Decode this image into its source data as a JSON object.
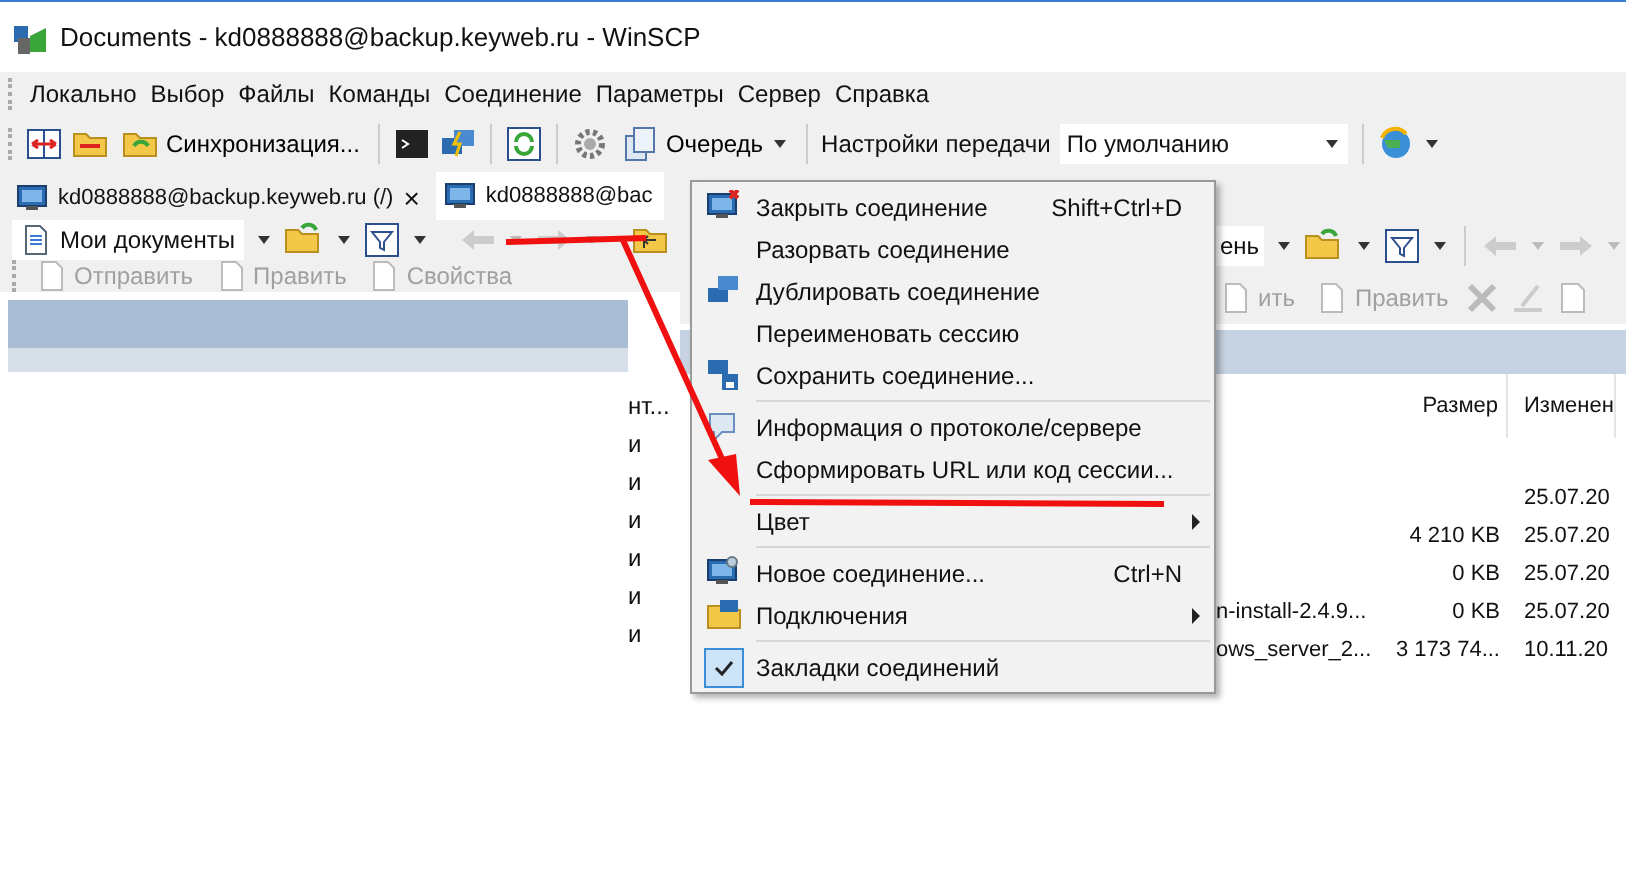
{
  "window": {
    "title": "Documents - kd0888888@backup.keyweb.ru - WinSCP"
  },
  "menu_bar": [
    "Локально",
    "Выбор",
    "Файлы",
    "Команды",
    "Соединение",
    "Параметры",
    "Сервер",
    "Справка"
  ],
  "toolbar": {
    "sync_label": "Синхронизация...",
    "queue_label": "Очередь",
    "transfer_label": "Настройки передачи",
    "transfer_value": "По умолчанию"
  },
  "tabs": [
    {
      "label": "kd0888888@backup.keyweb.ru (/)",
      "selected": false,
      "close": "×"
    },
    {
      "label": "kd0888888@bac",
      "selected": true
    }
  ],
  "left_panel": {
    "path": "Мои документы",
    "actions": [
      {
        "label": "Отправить",
        "disabled": true
      },
      {
        "label": "Править",
        "disabled": true
      },
      {
        "label": "Свойства",
        "disabled": true
      }
    ],
    "fragments": [
      "нт...",
      "и",
      "и",
      "и",
      "и",
      "и",
      "и"
    ]
  },
  "right_panel": {
    "path": "ень",
    "actions": [
      {
        "label": "ить",
        "disabled": true
      },
      {
        "label": "Править",
        "disabled": true
      }
    ],
    "columns": [
      "Размер",
      "Изменен"
    ],
    "rows": [
      {
        "name": "",
        "size": "",
        "modified": "25.07.20"
      },
      {
        "name": "",
        "size": "4 210 KB",
        "modified": "25.07.20"
      },
      {
        "name": "",
        "size": "0 KB",
        "modified": "25.07.20"
      },
      {
        "name": "n-install-2.4.9...",
        "size": "0 KB",
        "modified": "25.07.20"
      },
      {
        "name": "ows_server_2...",
        "size": "3 173 74...",
        "modified": "10.11.20"
      }
    ]
  },
  "context_menu": [
    {
      "kind": "item",
      "label": "Закрыть соединение",
      "shortcut": "Shift+Ctrl+D"
    },
    {
      "kind": "item",
      "label": "Разорвать соединение"
    },
    {
      "kind": "item",
      "label": "Дублировать соединение"
    },
    {
      "kind": "item",
      "label": "Переименовать сессию"
    },
    {
      "kind": "item",
      "label": "Сохранить соединение..."
    },
    {
      "kind": "separator"
    },
    {
      "kind": "item",
      "label": "Информация о протоколе/сервере"
    },
    {
      "kind": "item",
      "label": "Сформировать URL или код сессии..."
    },
    {
      "kind": "separator"
    },
    {
      "kind": "submenu",
      "label": "Цвет"
    },
    {
      "kind": "separator"
    },
    {
      "kind": "item",
      "label": "Новое соединение...",
      "shortcut": "Ctrl+N"
    },
    {
      "kind": "submenu",
      "label": "Подключения"
    },
    {
      "kind": "separator"
    },
    {
      "kind": "check",
      "label": "Закладки соединений",
      "checked": true
    }
  ]
}
